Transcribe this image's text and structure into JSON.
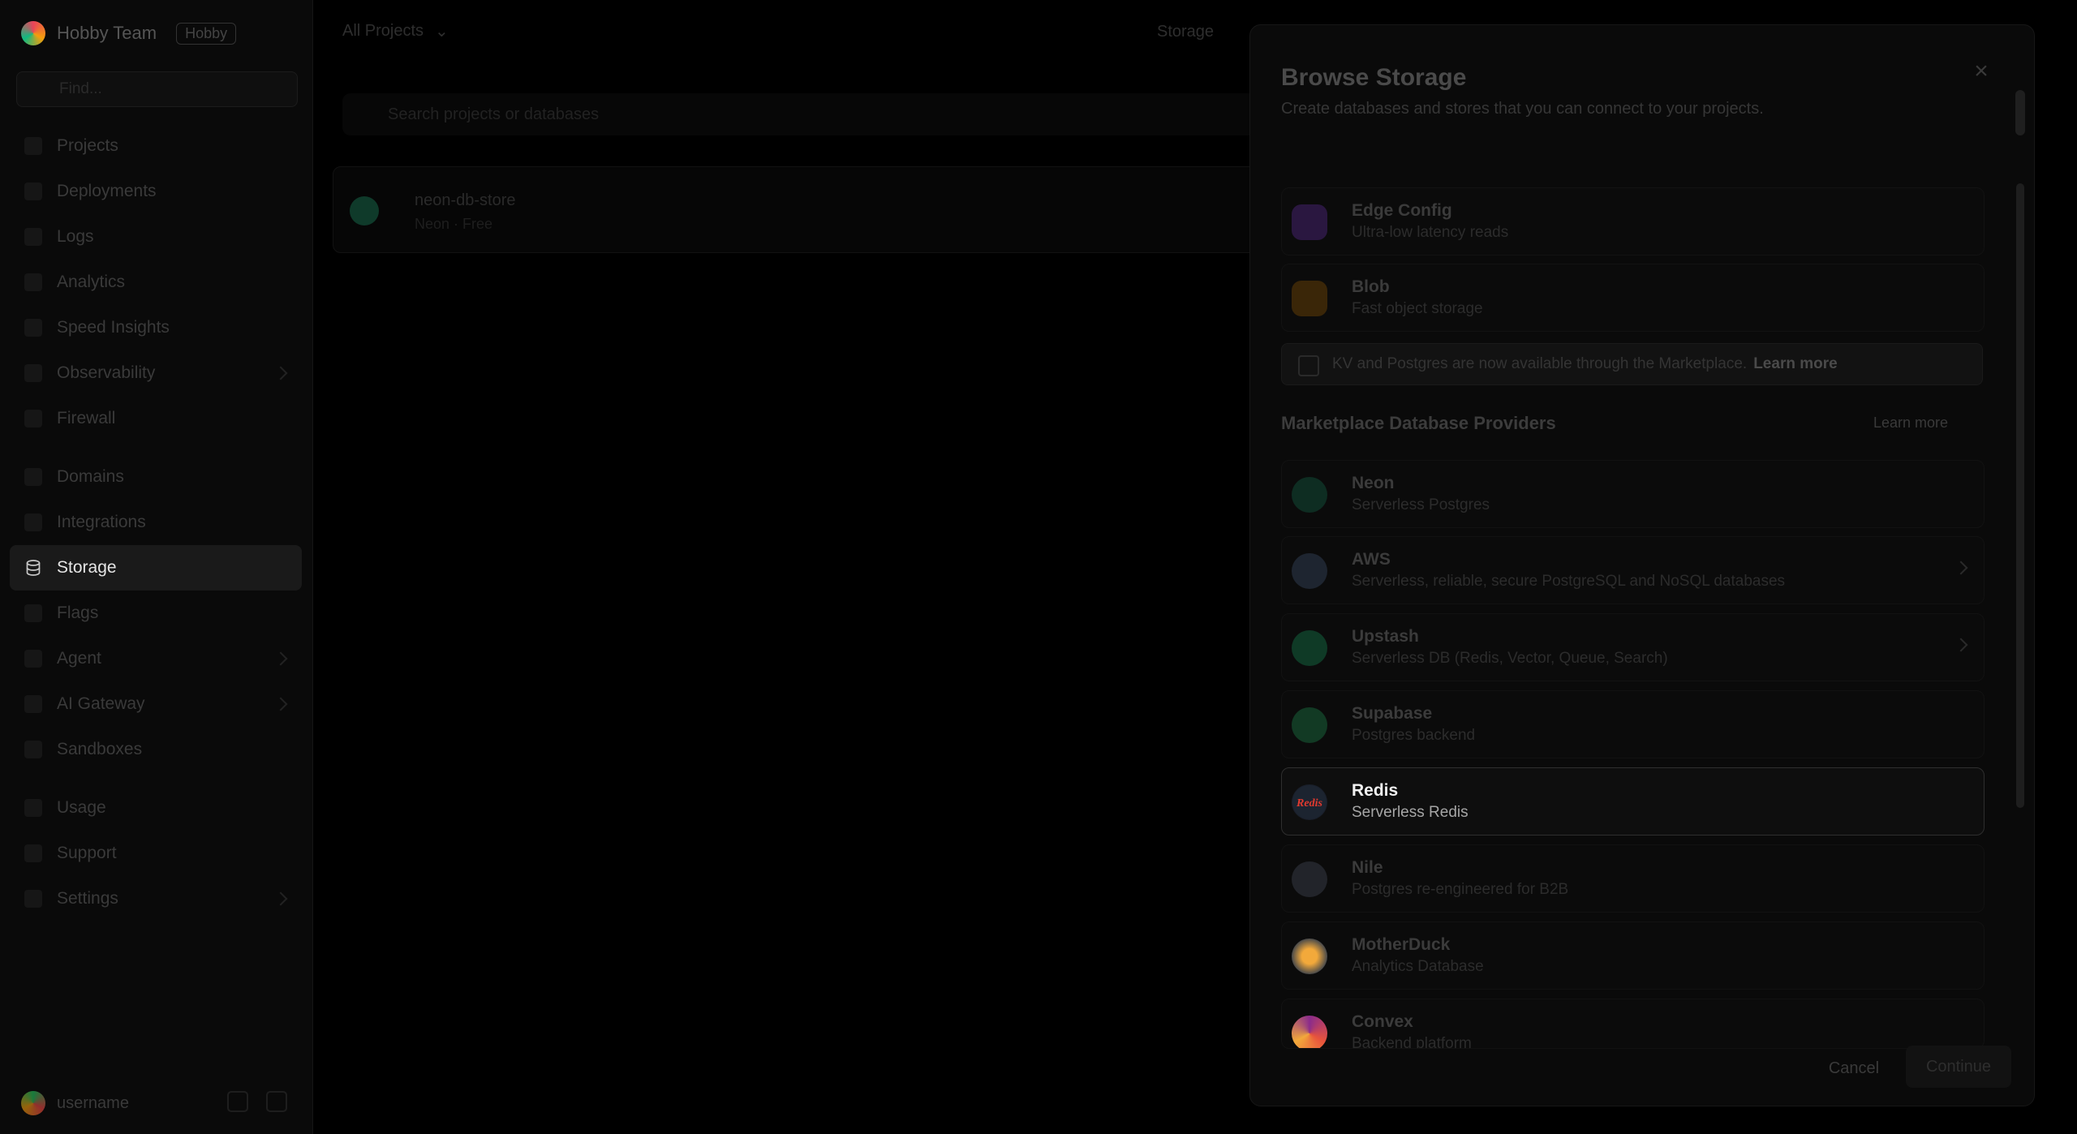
{
  "sidebar": {
    "team_name": "Hobby Team",
    "team_badge": "Hobby",
    "search_placeholder": "Find...",
    "items": [
      {
        "label": "Projects"
      },
      {
        "label": "Deployments"
      },
      {
        "label": "Logs"
      },
      {
        "label": "Analytics"
      },
      {
        "label": "Speed Insights"
      },
      {
        "label": "Observability"
      },
      {
        "label": "Firewall"
      },
      {
        "label": "Domains"
      },
      {
        "label": "Integrations"
      },
      {
        "label": "Storage"
      },
      {
        "label": "Flags"
      },
      {
        "label": "Agent"
      },
      {
        "label": "AI Gateway"
      },
      {
        "label": "Sandboxes"
      },
      {
        "label": "Usage"
      },
      {
        "label": "Support"
      },
      {
        "label": "Settings"
      }
    ],
    "active_index": 9,
    "user_name": "username"
  },
  "main": {
    "breadcrumb": "All Projects",
    "top_right": "Storage",
    "search_placeholder": "Search projects or databases",
    "card_title": "neon-db-store",
    "card_sub": "Neon · Free"
  },
  "drawer": {
    "title": "Browse Storage",
    "subtitle": "Create databases and stores that you can connect to your projects.",
    "native": [
      {
        "name": "Edge Config",
        "desc": "Ultra-low latency reads"
      },
      {
        "name": "Blob",
        "desc": "Fast object storage"
      }
    ],
    "notice": "KV and Postgres are now available through the Marketplace.",
    "notice_link": "Learn more",
    "section_title": "Marketplace Database Providers",
    "section_link": "Learn more",
    "providers": [
      {
        "name": "Neon",
        "desc": "Serverless Postgres"
      },
      {
        "name": "AWS",
        "desc": "Serverless, reliable, secure PostgreSQL and NoSQL databases"
      },
      {
        "name": "Upstash",
        "desc": "Serverless DB (Redis, Vector, Queue, Search)"
      },
      {
        "name": "Supabase",
        "desc": "Postgres backend"
      },
      {
        "name": "Redis",
        "desc": "Serverless Redis"
      },
      {
        "name": "Nile",
        "desc": "Postgres re-engineered for B2B"
      },
      {
        "name": "MotherDuck",
        "desc": "Analytics Database"
      },
      {
        "name": "Convex",
        "desc": "Backend platform"
      }
    ],
    "cancel_label": "Cancel",
    "continue_label": "Continue"
  }
}
